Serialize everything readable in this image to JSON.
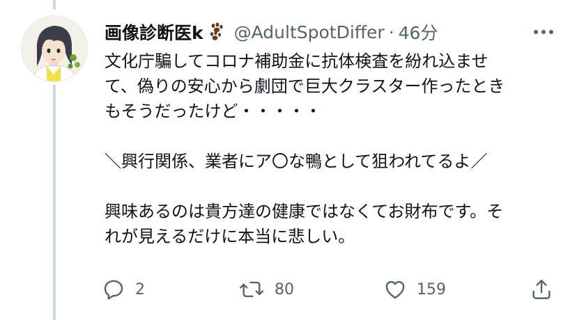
{
  "tweet": {
    "author": {
      "display_name": "画像診断医k",
      "name_emoji": "paw-prints-icon",
      "handle": "@AdultSpotDiffer",
      "separator": "·",
      "time": "46分"
    },
    "body": {
      "paragraphs": [
        "文化庁騙してコロナ補助金に抗体検査を紛れ込ませ\nて、偽りの安心から劇団で巨大クラスター作ったとき\nもそうだったけど・・・・・",
        "＼興行関係、業者にア〇な鴨として狙われてるよ／",
        "興味あるのは貴方達の健康ではなくてお財布です。そ\nれが見えるだけに本当に悲しい。"
      ]
    },
    "actions": {
      "reply": {
        "icon": "reply-icon",
        "count": "2"
      },
      "retweet": {
        "icon": "retweet-icon",
        "count": "80"
      },
      "like": {
        "icon": "heart-icon",
        "count": "159"
      },
      "share": {
        "icon": "share-icon"
      }
    }
  },
  "colors": {
    "text_primary": "#0f1419",
    "text_secondary": "#536471",
    "thread_line": "#cfd9de",
    "paw": "#6b3a1e"
  }
}
